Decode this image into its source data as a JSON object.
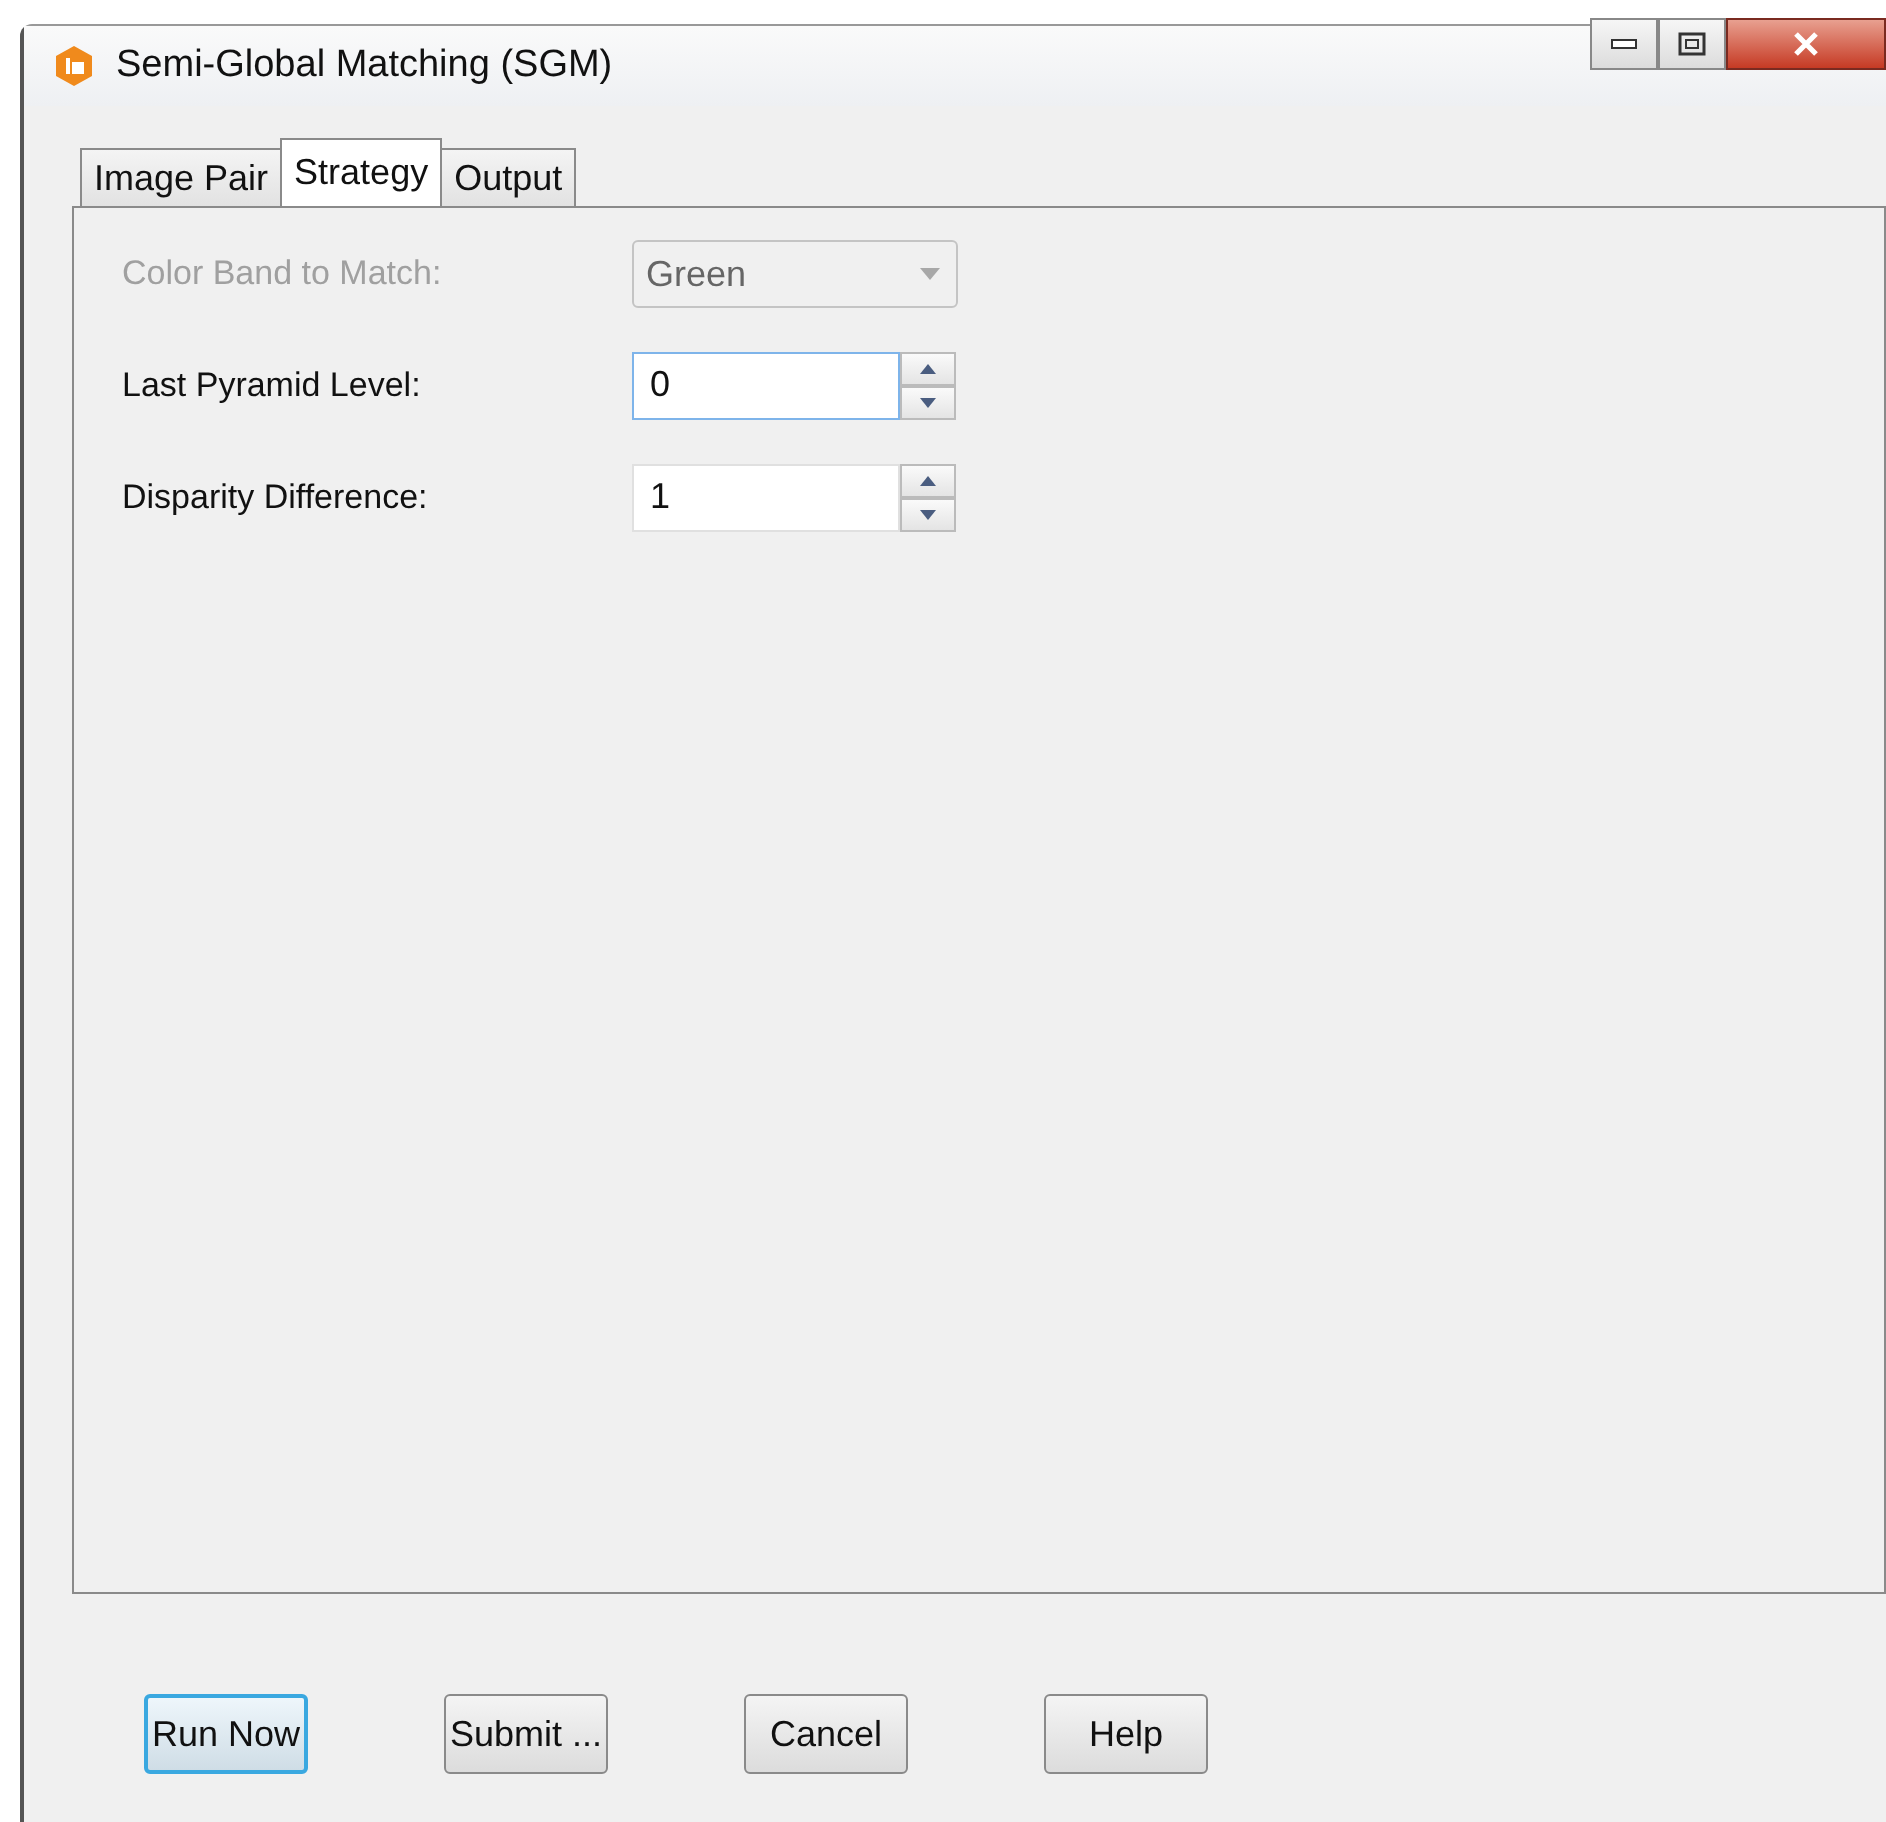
{
  "window": {
    "title": "Semi-Global Matching (SGM)"
  },
  "tabs": [
    {
      "label": "Image Pair",
      "selected": false
    },
    {
      "label": "Strategy",
      "selected": true
    },
    {
      "label": "Output",
      "selected": false
    }
  ],
  "fields": [
    {
      "kind": "dropdown",
      "label": "Color Band to Match:",
      "value": "Green",
      "disabled": true
    },
    {
      "kind": "spinner",
      "label": "Last Pyramid Level:",
      "value": "0",
      "disabled": false,
      "focused": true
    },
    {
      "kind": "spinner",
      "label": "Disparity Difference:",
      "value": "1",
      "disabled": false,
      "focused": false
    }
  ],
  "buttons": [
    {
      "label": "Run Now",
      "focused": true
    },
    {
      "label": "Submit ...",
      "focused": false
    },
    {
      "label": "Cancel",
      "focused": false
    },
    {
      "label": "Help",
      "focused": false
    }
  ]
}
